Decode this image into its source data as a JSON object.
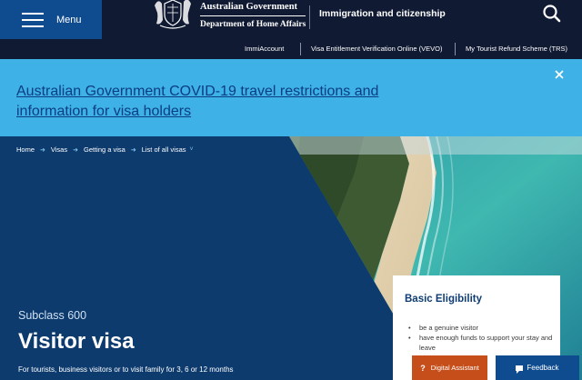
{
  "header": {
    "menu_label": "Menu",
    "gov_line1": "Australian Government",
    "gov_line2": "Department of Home Affairs",
    "section_title": "Immigration and citizenship"
  },
  "utility_links": [
    "ImmiAccount",
    "Visa Entitlement Verification Online (VEVO)",
    "My Tourist Refund Scheme (TRS)"
  ],
  "banner": {
    "text": "Australian Government COVID-19 travel restrictions and information for visa holders"
  },
  "breadcrumb": [
    "Home",
    "Visas",
    "Getting a visa",
    "List of all visas"
  ],
  "hero": {
    "subclass": "Subclass 600",
    "title": "Visitor visa",
    "description": "For tourists, business visitors or to visit family for 3, 6 or 12 months"
  },
  "eligibility": {
    "title": "Basic Eligibility",
    "items": [
      "be a genuine visitor",
      "have enough funds to support your stay and leave"
    ]
  },
  "buttons": {
    "assistant": "Digital Assistant",
    "feedback": "Feedback"
  },
  "colors": {
    "header_navy": "#101a33",
    "menu_blue": "#0f4c8f",
    "banner_blue": "#3eb1e6",
    "hero_navy": "#0d3b6e",
    "assistant_orange": "#c54e1a"
  },
  "icons": [
    "hamburger-icon",
    "crest-icon",
    "search-icon",
    "close-icon",
    "chevron-right-icon",
    "question-icon",
    "chat-icon"
  ]
}
